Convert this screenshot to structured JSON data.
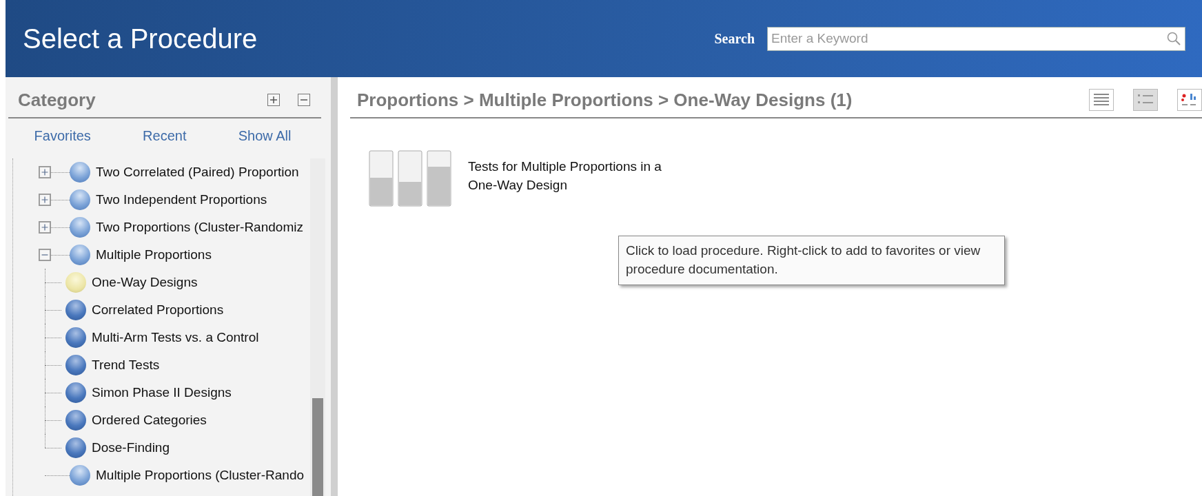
{
  "header": {
    "title": "Select a Procedure",
    "search_label": "Search",
    "search": {
      "placeholder": "Enter a Keyword"
    }
  },
  "sidebar": {
    "title": "Category",
    "links": [
      {
        "label": "Favorites"
      },
      {
        "label": "Recent"
      },
      {
        "label": "Show All"
      }
    ],
    "tree": [
      {
        "label": "Two Correlated (Paired) Proportion",
        "selected": false,
        "expanded": false
      },
      {
        "label": "Two Independent Proportions",
        "selected": false,
        "expanded": false
      },
      {
        "label": "Two Proportions (Cluster-Randomiz",
        "selected": false,
        "expanded": false
      },
      {
        "label": "Multiple Proportions",
        "selected": false,
        "expanded": true,
        "children": [
          {
            "label": "One-Way Designs",
            "selected": true
          },
          {
            "label": "Correlated Proportions",
            "selected": false
          },
          {
            "label": "Multi-Arm Tests vs. a Control",
            "selected": false
          },
          {
            "label": "Trend Tests",
            "selected": false
          },
          {
            "label": "Simon Phase II Designs",
            "selected": false
          },
          {
            "label": "Ordered Categories",
            "selected": false
          },
          {
            "label": "Dose-Finding",
            "selected": false
          }
        ]
      },
      {
        "label": "Multiple Proportions (Cluster-Rando",
        "selected": false
      }
    ]
  },
  "content": {
    "breadcrumb": "Proportions > Multiple Proportions > One-Way Designs (1)",
    "view_buttons": [
      {
        "kind": "list",
        "selected": false
      },
      {
        "kind": "details",
        "selected": true
      },
      {
        "kind": "chart",
        "selected": false
      }
    ],
    "procedures": [
      {
        "lines": [
          "Tests for Multiple Proportions in a",
          "One-Way Design"
        ]
      }
    ],
    "tooltip": {
      "lines": [
        "Click to load procedure. Right-click to add to favorites or view",
        "procedure documentation."
      ]
    }
  }
}
